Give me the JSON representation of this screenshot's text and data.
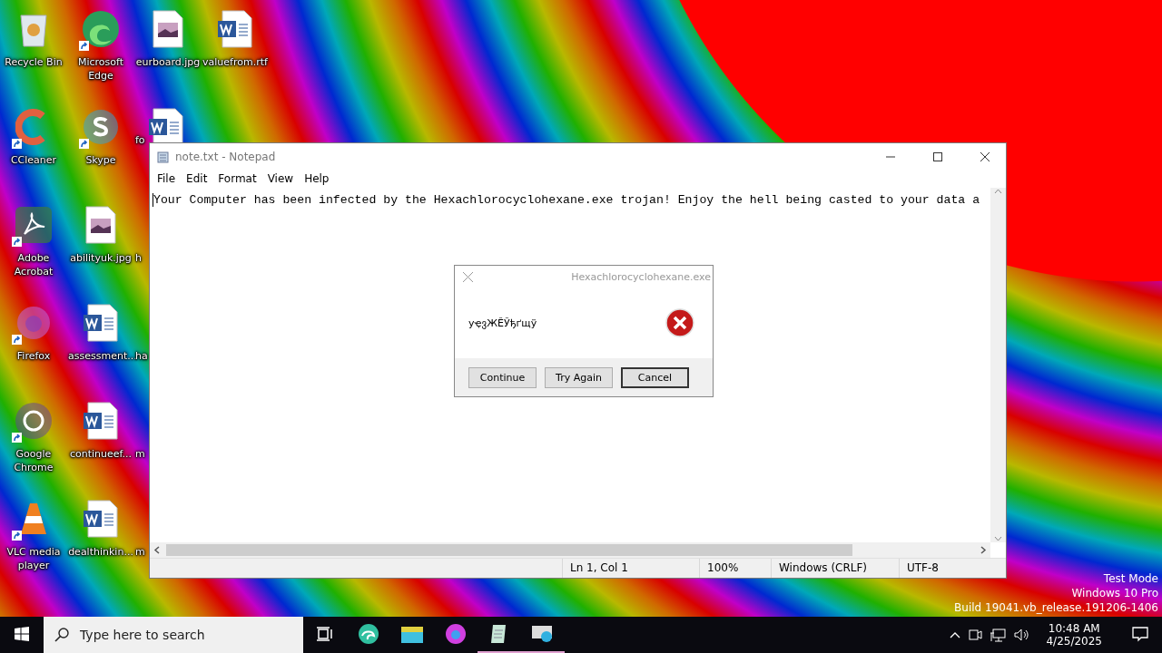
{
  "desktop": {
    "columns": [
      [
        {
          "label": "Recycle Bin",
          "kind": "recycle",
          "shortcut": false,
          "covered": false
        },
        {
          "label": "CCleaner",
          "kind": "ccleaner",
          "shortcut": true,
          "covered": false
        },
        {
          "label": "Adobe Acrobat",
          "kind": "pdf",
          "shortcut": true,
          "covered": false
        },
        {
          "label": "Firefox",
          "kind": "firefox",
          "shortcut": true,
          "covered": false
        },
        {
          "label": "Google Chrome",
          "kind": "chrome",
          "shortcut": true,
          "covered": false
        },
        {
          "label": "VLC media player",
          "kind": "vlc",
          "shortcut": true,
          "covered": false
        }
      ],
      [
        {
          "label": "Microsoft Edge",
          "kind": "edge",
          "shortcut": true,
          "covered": false
        },
        {
          "label": "Skype",
          "kind": "skype",
          "shortcut": true,
          "covered": false
        },
        {
          "label": "abilityuk.jpg",
          "kind": "image",
          "shortcut": false,
          "covered": false
        },
        {
          "label": "assessment...",
          "kind": "word",
          "shortcut": false,
          "covered": false
        },
        {
          "label": "continueef...",
          "kind": "word",
          "shortcut": false,
          "covered": false
        },
        {
          "label": "dealthinkin...",
          "kind": "word",
          "shortcut": false,
          "covered": false
        }
      ],
      [
        {
          "label": "eurboard.jpg",
          "kind": "image",
          "shortcut": false,
          "covered": false
        },
        {
          "label": "fo",
          "kind": "word",
          "shortcut": false,
          "covered": true
        },
        {
          "label": "h",
          "kind": "none",
          "covered": true
        },
        {
          "label": "ha",
          "kind": "none",
          "covered": true
        },
        {
          "label": "m",
          "kind": "none",
          "covered": true
        },
        {
          "label": "m",
          "kind": "none",
          "covered": true
        }
      ],
      [
        {
          "label": "valuefrom.rtf",
          "kind": "word",
          "shortcut": false,
          "covered": false
        }
      ]
    ]
  },
  "notepad": {
    "title": "note.txt - Notepad",
    "menu": [
      "File",
      "Edit",
      "Format",
      "View",
      "Help"
    ],
    "text": "Your Computer has been infected by the Hexachlorocyclohexane.exe trojan! Enjoy the hell being casted to your data a",
    "status": [
      "Ln 1, Col 1",
      "100%",
      "Windows (CRLF)",
      "UTF-8"
    ]
  },
  "dialog": {
    "title": "Hexachlorocyclohexane.exe",
    "message": "уҿვЖĔЎђґщӱ",
    "buttons": [
      {
        "label": "Continue",
        "focused": false
      },
      {
        "label": "Try Again",
        "focused": false
      },
      {
        "label": "Cancel",
        "focused": true
      }
    ]
  },
  "watermark_text": [
    "Test Mode",
    "Windows 10 Pro",
    "Build 19041.vb_release.191206-1406"
  ],
  "taskbar": {
    "search_placeholder": "Type here to search",
    "apps": [
      {
        "kind": "edge",
        "running": false
      },
      {
        "kind": "folder",
        "running": false
      },
      {
        "kind": "firefox",
        "running": false
      },
      {
        "kind": "notepad",
        "running": true
      },
      {
        "kind": "app",
        "running": true
      }
    ],
    "time": "10:48 AM",
    "date": "4/25/2025"
  }
}
